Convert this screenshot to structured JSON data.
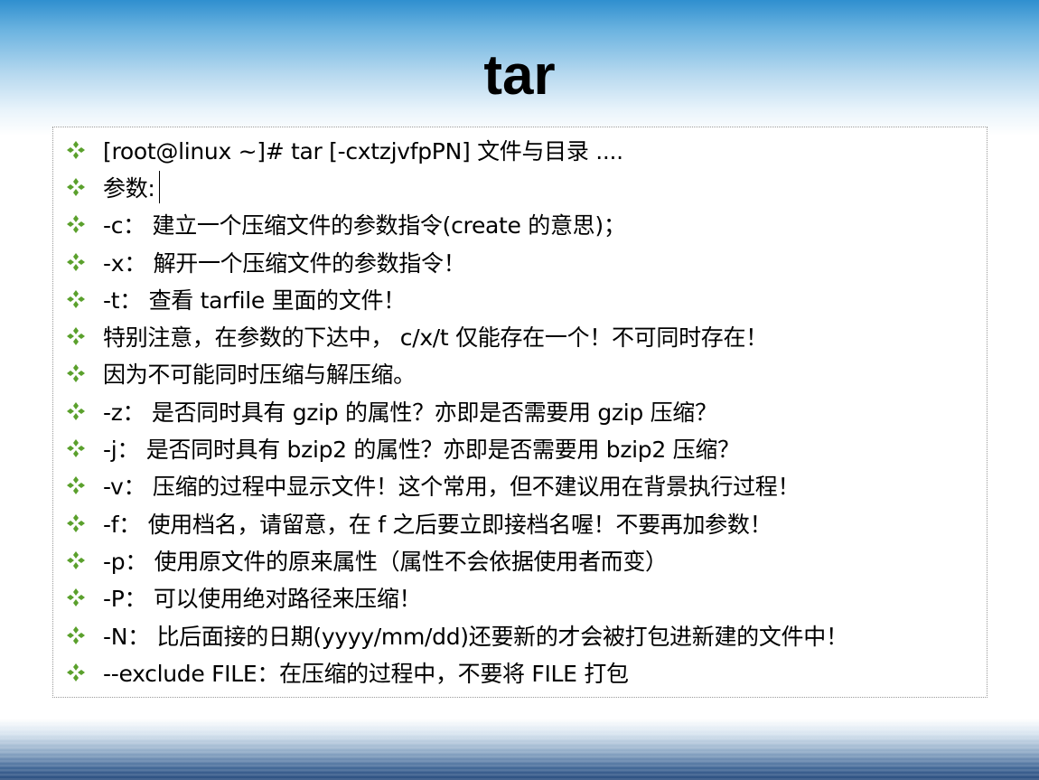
{
  "slide": {
    "title": "tar",
    "bullet_icon": "green-four-diamond-bullet-icon",
    "bullet_color": "#5aa02c",
    "items": [
      "[root@linux ~]# tar [-cxtzjvfpPN] 文件与目录 ....",
      "参数:",
      "-c： 建立一个压缩文件的参数指令(create 的意思)；",
      "-x： 解开一个压缩文件的参数指令！",
      "-t： 查看 tarfile 里面的文件！",
      "特别注意，在参数的下达中， c/x/t 仅能存在一个！不可同时存在！",
      "因为不可能同时压缩与解压缩。",
      "-z： 是否同时具有 gzip 的属性？亦即是否需要用 gzip 压缩？",
      "-j： 是否同时具有 bzip2 的属性？亦即是否需要用 bzip2 压缩？",
      "-v： 压缩的过程中显示文件！这个常用，但不建议用在背景执行过程！",
      "-f： 使用档名，请留意，在 f 之后要立即接档名喔！不要再加参数！",
      "-p： 使用原文件的原来属性（属性不会依据使用者而变）",
      "-P： 可以使用绝对路径来压缩！",
      "-N： 比后面接的日期(yyyy/mm/dd)还要新的才会被打包进新建的文件中！",
      "--exclude FILE：在压缩的过程中，不要将 FILE 打包"
    ]
  }
}
